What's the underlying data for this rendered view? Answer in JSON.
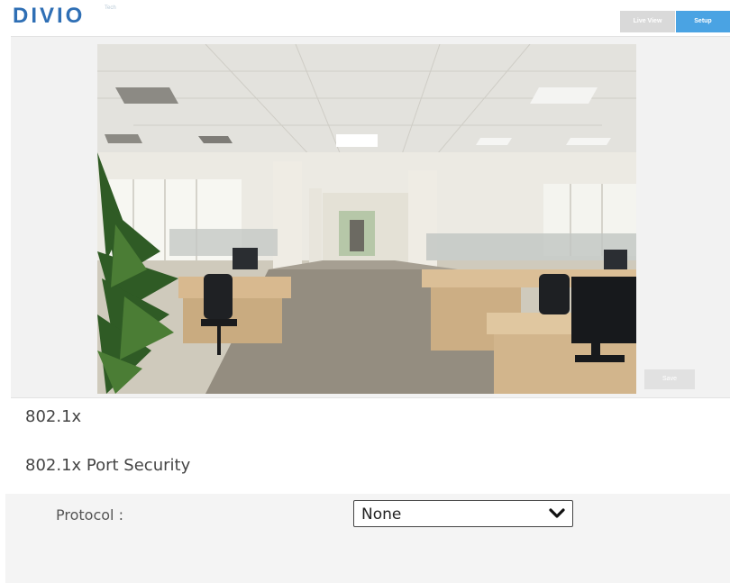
{
  "header": {
    "logo_text": "DIVIO",
    "logo_sub": "Tech",
    "nav": {
      "live_view": "Live View",
      "setup": "Setup"
    },
    "active_tab": "Setup"
  },
  "viewer": {
    "save_label": "Save"
  },
  "main": {
    "section_title": "802.1x",
    "subsection_title": "802.1x Port Security",
    "protocol": {
      "label": "Protocol :",
      "selected": "None"
    }
  },
  "colors": {
    "logo": "#2f6fb5",
    "setup_tab": "#4aa3e3",
    "inactive_tab": "#d9d9d9"
  },
  "icons": {
    "select_arrow": "chevron-down-icon"
  }
}
